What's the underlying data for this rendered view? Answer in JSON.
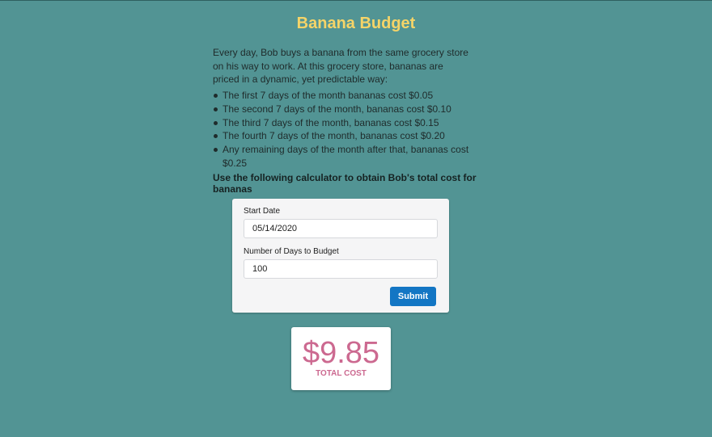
{
  "page": {
    "title": "Banana Budget",
    "intro": "Every day, Bob buys a banana from the same grocery store on his way to work. At this grocery store, bananas are priced in a dynamic, yet predictable way:",
    "rules": [
      "The first 7 days of the month bananas cost $0.05",
      "The second 7 days of the month, bananas cost $0.10",
      "The third 7 days of the month, bananas cost $0.15",
      "The fourth 7 days of the month, bananas cost $0.20",
      "Any remaining days of the month after that, bananas cost $0.25"
    ],
    "cta": "Use the following calculator to obtain Bob's total cost for bananas"
  },
  "form": {
    "start_date_label": "Start Date",
    "start_date_value": "05/14/2020",
    "days_label": "Number of Days to Budget",
    "days_value": "100",
    "submit_label": "Submit"
  },
  "result": {
    "value": "$9.85",
    "label": "TOTAL COST"
  },
  "colors": {
    "background": "#529494",
    "title": "#f5d468",
    "accent_button": "#1376c4",
    "result": "#cc6990"
  }
}
